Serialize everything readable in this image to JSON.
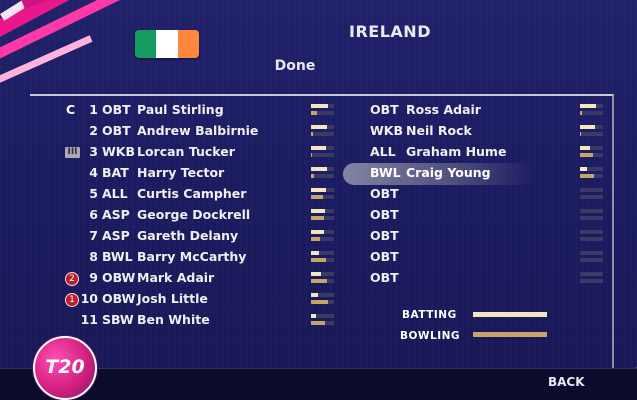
{
  "header": {
    "team_name": "IRELAND",
    "done_label": "Done",
    "flag_colors": [
      "#169b62",
      "#ffffff",
      "#ff883e"
    ]
  },
  "markers": {
    "captain": "C",
    "keeper": "III"
  },
  "players": [
    {
      "num": "1",
      "role": "OBT",
      "name": "Paul Stirling",
      "batting": 0.75,
      "bowling": 0.25
    },
    {
      "num": "2",
      "role": "OBT",
      "name": "Andrew Balbirnie",
      "batting": 0.7,
      "bowling": 0.1
    },
    {
      "num": "3",
      "role": "WKB",
      "name": "Lorcan Tucker",
      "batting": 0.65,
      "bowling": 0.05
    },
    {
      "num": "4",
      "role": "BAT",
      "name": "Harry Tector",
      "batting": 0.7,
      "bowling": 0.15
    },
    {
      "num": "5",
      "role": "ALL",
      "name": "Curtis Campher",
      "batting": 0.65,
      "bowling": 0.5
    },
    {
      "num": "6",
      "role": "ASP",
      "name": "George Dockrell",
      "batting": 0.6,
      "bowling": 0.55
    },
    {
      "num": "7",
      "role": "ASP",
      "name": "Gareth Delany",
      "batting": 0.55,
      "bowling": 0.4
    },
    {
      "num": "8",
      "role": "BWL",
      "name": "Barry McCarthy",
      "batting": 0.35,
      "bowling": 0.65
    },
    {
      "num": "9",
      "role": "OBW",
      "name": "Mark Adair",
      "batting": 0.45,
      "bowling": 0.7,
      "badge": "2"
    },
    {
      "num": "10",
      "role": "OBW",
      "name": "Josh Little",
      "batting": 0.3,
      "bowling": 0.75,
      "badge": "1"
    },
    {
      "num": "11",
      "role": "SBW",
      "name": "Ben White",
      "batting": 0.2,
      "bowling": 0.6
    }
  ],
  "reserves": [
    {
      "role": "OBT",
      "name": "Ross Adair",
      "batting": 0.7,
      "bowling": 0.1
    },
    {
      "role": "WKB",
      "name": "Neil Rock",
      "batting": 0.65,
      "bowling": 0.05
    },
    {
      "role": "ALL",
      "name": "Graham Hume",
      "batting": 0.45,
      "bowling": 0.55
    },
    {
      "role": "BWL",
      "name": "Craig Young",
      "batting": 0.3,
      "bowling": 0.6
    },
    {
      "role": "OBT",
      "name": "",
      "batting": 0,
      "bowling": 0
    },
    {
      "role": "OBT",
      "name": "",
      "batting": 0,
      "bowling": 0
    },
    {
      "role": "OBT",
      "name": "",
      "batting": 0,
      "bowling": 0
    },
    {
      "role": "OBT",
      "name": "",
      "batting": 0,
      "bowling": 0
    },
    {
      "role": "OBT",
      "name": "",
      "batting": 0,
      "bowling": 0
    }
  ],
  "selected_reserve_index": 3,
  "legend": {
    "batting_label": "BATTING",
    "bowling_label": "BOWLING",
    "batting_color": "#f3e7bf",
    "bowling_color": "#c7a46a"
  },
  "logo": {
    "text": "T20"
  },
  "footer": {
    "back_label": "BACK"
  }
}
